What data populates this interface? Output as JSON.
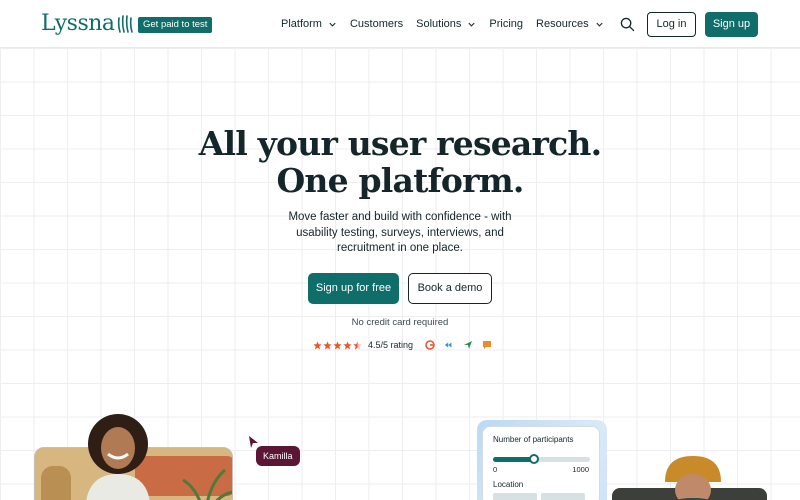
{
  "header": {
    "logo_text": "Lyssna",
    "badge": "Get paid to test",
    "nav": [
      {
        "label": "Platform",
        "dropdown": true
      },
      {
        "label": "Customers",
        "dropdown": false
      },
      {
        "label": "Solutions",
        "dropdown": true
      },
      {
        "label": "Pricing",
        "dropdown": false
      },
      {
        "label": "Resources",
        "dropdown": true
      }
    ],
    "login_label": "Log in",
    "signup_label": "Sign up",
    "search_icon": "search-icon"
  },
  "hero": {
    "title_line1": "All your user research.",
    "title_line2": "One platform.",
    "subtitle": "Move faster and build with confidence - with usability testing, surveys, interviews, and recruitment in one place.",
    "cta_primary": "Sign up for free",
    "cta_secondary": "Book a demo",
    "no_credit_card": "No credit card required",
    "rating": {
      "stars": 4.5,
      "text": "4.5/5 rating",
      "review_sites": [
        "g2-icon",
        "capterra-icon",
        "getapp-icon",
        "software-advice-icon"
      ]
    }
  },
  "preview": {
    "cursor_name": "Kamilla",
    "participants_label": "Number of participants",
    "slider_min": "0",
    "slider_max": "1000",
    "slider_value_fraction": 0.42,
    "location_label": "Location"
  },
  "colors": {
    "brand": "#0f6d6a",
    "star": "#e8572e",
    "name_tag": "#5a1634"
  }
}
